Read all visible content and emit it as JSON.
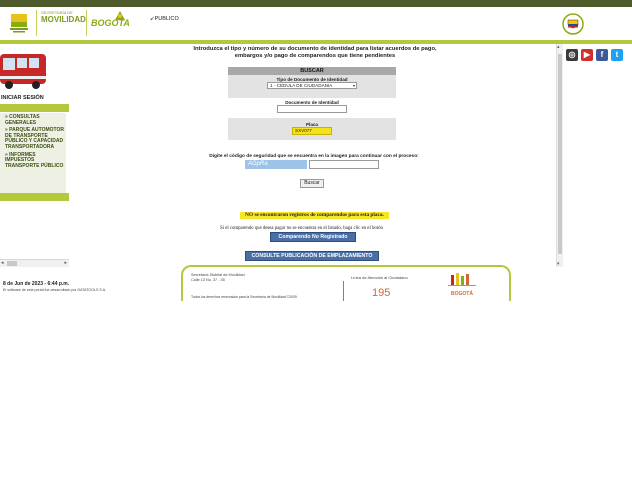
{
  "header": {
    "secretaria_text": "SECRETARÍA DE",
    "movilidad_text": "MOVILIDAD",
    "bogota_text": "BOGOTA",
    "publico_text": "PUBLICO"
  },
  "sidebar": {
    "iniciar_sesion": "INICIAR SESIÓN",
    "menu": [
      "» CONSULTAS GENERALES",
      "» PARQUE AUTOMOTOR DE TRANSPORTE PÚBLICO Y CAPACIDAD TRANSPORTADORA",
      "» INFORMES IMPUESTOS TRANSPORTE PÚBLICO"
    ],
    "date": "8 de Jun de 2023 - 6:44 p.m.",
    "copyright": "El software de este portal fue desarrollado por DATATOOLS S.A."
  },
  "main": {
    "intro": "Introduzca el tipo y número de su documento de identidad para listar acuerdos de pago, embargos y/o pago de comparendos que tiene pendientes",
    "panel_title": "BUSCAR",
    "tipo_doc_label": "Tipo de Documento de Identidad",
    "tipo_doc_value": "1 - CEDULA DE CIUDADANIA",
    "doc_label": "Documento de Identidad",
    "doc_value": "",
    "placa_label": "Placa",
    "placa_value": "SXV077",
    "captcha_label": "Digite el código de seguridad que se encuentra en la imagen para continuar con el proceso:",
    "captcha_text": "AGpRa",
    "captcha_value": "",
    "buscar_button": "Buscar",
    "no_registros": "NO se encontraron registros de comparendos para esta placa.",
    "si_texto": "Si el comparendo que desea pagar no se encuentra en el listado, haga clic en el botón",
    "comparendo_button": "Comparendo No Registrado",
    "consulte_button": "CONSULTE PUBLICACIÓN DE EMPLAZAMIENTO"
  },
  "footer": {
    "line1": "Secretaría Distrital de Movilidad",
    "line2": "Calle 13 No. 37 - 35",
    "rights": "Todos los derechos reservados para la Secretaría de Movilidad ©2009",
    "linea_label": "Línea de Atención al Ciudadano",
    "linea_number": "195",
    "right_logo_text": "BOGOTÁ"
  },
  "social": [
    "instagram-icon",
    "youtube-icon",
    "facebook-icon",
    "twitter-icon"
  ],
  "colors": {
    "brand_green": "#b5c83b",
    "top_bar": "#4f5a2c",
    "button_blue": "#4a6fa5",
    "highlight_yellow": "#f5e626"
  }
}
